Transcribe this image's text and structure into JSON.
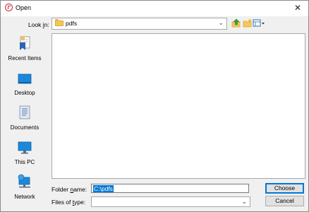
{
  "window": {
    "title": "Open",
    "close_glyph": "✕"
  },
  "toolbar": {
    "look_in_label_prefix": "Look ",
    "look_in_label_accel": "i",
    "look_in_label_suffix": "n:",
    "look_in_value": "pdfs",
    "combo_arrow": "⌄",
    "icons": [
      "folder-icon",
      "up-one-level-icon",
      "new-folder-icon",
      "view-menu-icon"
    ]
  },
  "places": [
    {
      "label": "Recent Items",
      "icon": "recent-items-icon"
    },
    {
      "label": "Desktop",
      "icon": "desktop-icon"
    },
    {
      "label": "Documents",
      "icon": "documents-icon"
    },
    {
      "label": "This PC",
      "icon": "this-pc-icon"
    },
    {
      "label": "Network",
      "icon": "network-icon"
    }
  ],
  "file_list": {
    "items": []
  },
  "form": {
    "folder_name_prefix": "Folder ",
    "folder_name_accel": "n",
    "folder_name_suffix": "ame:",
    "folder_name_value": "C:\\pdfs",
    "files_of_type_prefix": "Files of ",
    "files_of_type_accel": "t",
    "files_of_type_suffix": "ype:",
    "files_of_type_value": "",
    "combo_arrow": "⌄"
  },
  "buttons": {
    "choose": "Choose",
    "cancel": "Cancel"
  },
  "colors": {
    "accent": "#0078d7",
    "folder": "#f3c85a",
    "close_icon": "#c62828"
  }
}
